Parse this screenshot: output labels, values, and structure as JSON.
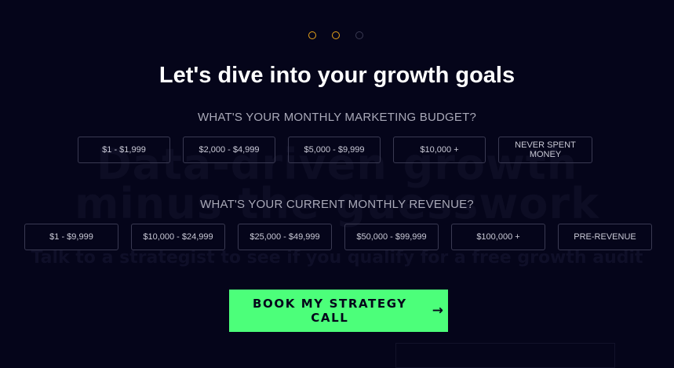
{
  "background_headline": {
    "line1": "Data-driven growth",
    "line2": "minus the guesswork",
    "subline": "Talk to a strategist to see if you qualify for a free growth audit"
  },
  "progress": {
    "steps_total": 3,
    "steps_done": 2
  },
  "title": "Let's dive into your growth goals",
  "budget": {
    "label": "WHAT'S YOUR MONTHLY MARKETING BUDGET?",
    "options": [
      "$1 - $1,999",
      "$2,000 - $4,999",
      "$5,000 - $9,999",
      "$10,000 +",
      "NEVER SPENT MONEY"
    ]
  },
  "revenue": {
    "label": "WHAT'S YOUR CURRENT MONTHLY REVENUE?",
    "options": [
      "$1 - $9,999",
      "$10,000 - $24,999",
      "$25,000 - $49,999",
      "$50,000 - $99,999",
      "$100,000 +",
      "PRE-REVENUE"
    ]
  },
  "cta": {
    "label": "BOOK MY STRATEGY CALL",
    "arrow": "→"
  },
  "colors": {
    "background": "#05051a",
    "accent": "#4cff7a",
    "progress_active": "#e6a21a",
    "progress_inactive": "#3a3a52"
  }
}
